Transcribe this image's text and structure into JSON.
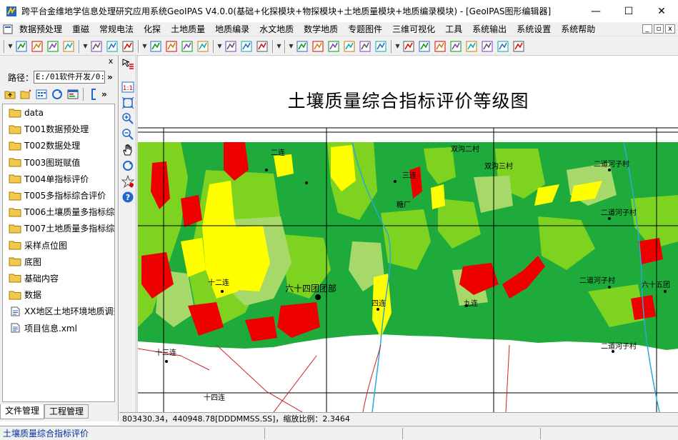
{
  "window": {
    "title": "跨平台金维地学信息处理研究应用系统GeoIPAS V4.0.0(基础+化探模块+物探模块+土地质量模块+地质编录模块) - [GeoIPAS图形编辑器]",
    "minimize": "—",
    "maximize": "☐",
    "close": "✕"
  },
  "menu": {
    "items": [
      "数据预处理",
      "重磁",
      "常规电法",
      "化探",
      "土地质量",
      "地质编录",
      "水文地质",
      "数学地质",
      "专题图件",
      "三维可视化",
      "工具",
      "系统输出",
      "系统设置",
      "系统帮助"
    ],
    "mdi": [
      "_",
      "▫",
      "x"
    ]
  },
  "left_panel": {
    "close": "x",
    "path_label": "路径：",
    "path_value": "E:/01软件开发/0:",
    "path_go": "»",
    "tools_more": "»",
    "files": [
      {
        "name": "data",
        "type": "folder"
      },
      {
        "name": "T001数据预处理",
        "type": "folder"
      },
      {
        "name": "T002数据处理",
        "type": "folder"
      },
      {
        "name": "T003图斑赋值",
        "type": "folder"
      },
      {
        "name": "T004单指标评价",
        "type": "folder"
      },
      {
        "name": "T005多指标综合评价",
        "type": "folder"
      },
      {
        "name": "T006土壤质量多指标综合",
        "type": "folder"
      },
      {
        "name": "T007土地质量多指标综合",
        "type": "folder"
      },
      {
        "name": "采样点位图",
        "type": "folder"
      },
      {
        "name": "底图",
        "type": "folder"
      },
      {
        "name": "基础内容",
        "type": "folder"
      },
      {
        "name": "数据",
        "type": "folder"
      },
      {
        "name": "XX地区土地环境地质调查",
        "type": "file"
      },
      {
        "name": "项目信息.xml",
        "type": "file"
      }
    ],
    "tabs": [
      "文件管理",
      "工程管理"
    ]
  },
  "map": {
    "title": "土壤质量综合指标评价等级图",
    "labels": [
      {
        "text": "二连"
      },
      {
        "text": "双沟二村"
      },
      {
        "text": "双沟三村"
      },
      {
        "text": "二道河子村"
      },
      {
        "text": "三连"
      },
      {
        "text": "二道河子村"
      },
      {
        "text": "糖厂"
      },
      {
        "text": "十二连"
      },
      {
        "text": "六十四团团部"
      },
      {
        "text": "二道河子村"
      },
      {
        "text": "六十五团"
      },
      {
        "text": "九连"
      },
      {
        "text": "四连"
      },
      {
        "text": "十三连"
      },
      {
        "text": "二道河子村"
      },
      {
        "text": "十四连"
      }
    ],
    "colors": {
      "dark_green": "#1faa3c",
      "mid_green": "#7ed321",
      "light_green": "#a6d96a",
      "yellow": "#ffff00",
      "red": "#ee0000"
    }
  },
  "coordbar": {
    "coords": "803430.34，440948.78[DDDMMSS.SS]，缩放比例：2.3464"
  },
  "status": {
    "text": "土壤质量综合指标评价"
  }
}
